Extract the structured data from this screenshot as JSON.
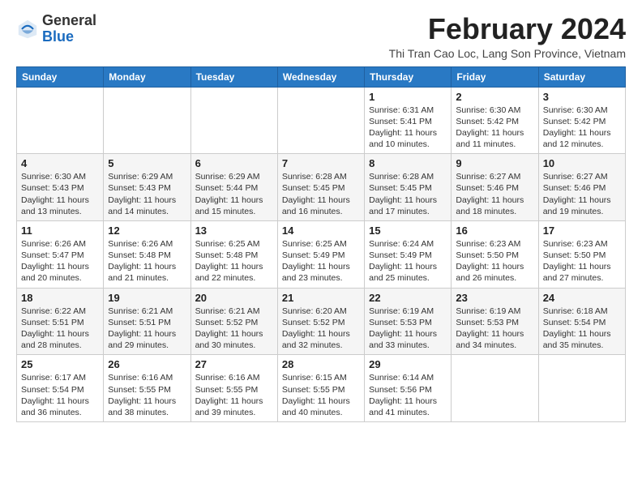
{
  "logo": {
    "general": "General",
    "blue": "Blue"
  },
  "title": "February 2024",
  "subtitle": "Thi Tran Cao Loc, Lang Son Province, Vietnam",
  "weekdays": [
    "Sunday",
    "Monday",
    "Tuesday",
    "Wednesday",
    "Thursday",
    "Friday",
    "Saturday"
  ],
  "weeks": [
    [
      {
        "day": "",
        "info": ""
      },
      {
        "day": "",
        "info": ""
      },
      {
        "day": "",
        "info": ""
      },
      {
        "day": "",
        "info": ""
      },
      {
        "day": "1",
        "info": "Sunrise: 6:31 AM\nSunset: 5:41 PM\nDaylight: 11 hours\nand 10 minutes."
      },
      {
        "day": "2",
        "info": "Sunrise: 6:30 AM\nSunset: 5:42 PM\nDaylight: 11 hours\nand 11 minutes."
      },
      {
        "day": "3",
        "info": "Sunrise: 6:30 AM\nSunset: 5:42 PM\nDaylight: 11 hours\nand 12 minutes."
      }
    ],
    [
      {
        "day": "4",
        "info": "Sunrise: 6:30 AM\nSunset: 5:43 PM\nDaylight: 11 hours\nand 13 minutes."
      },
      {
        "day": "5",
        "info": "Sunrise: 6:29 AM\nSunset: 5:43 PM\nDaylight: 11 hours\nand 14 minutes."
      },
      {
        "day": "6",
        "info": "Sunrise: 6:29 AM\nSunset: 5:44 PM\nDaylight: 11 hours\nand 15 minutes."
      },
      {
        "day": "7",
        "info": "Sunrise: 6:28 AM\nSunset: 5:45 PM\nDaylight: 11 hours\nand 16 minutes."
      },
      {
        "day": "8",
        "info": "Sunrise: 6:28 AM\nSunset: 5:45 PM\nDaylight: 11 hours\nand 17 minutes."
      },
      {
        "day": "9",
        "info": "Sunrise: 6:27 AM\nSunset: 5:46 PM\nDaylight: 11 hours\nand 18 minutes."
      },
      {
        "day": "10",
        "info": "Sunrise: 6:27 AM\nSunset: 5:46 PM\nDaylight: 11 hours\nand 19 minutes."
      }
    ],
    [
      {
        "day": "11",
        "info": "Sunrise: 6:26 AM\nSunset: 5:47 PM\nDaylight: 11 hours\nand 20 minutes."
      },
      {
        "day": "12",
        "info": "Sunrise: 6:26 AM\nSunset: 5:48 PM\nDaylight: 11 hours\nand 21 minutes."
      },
      {
        "day": "13",
        "info": "Sunrise: 6:25 AM\nSunset: 5:48 PM\nDaylight: 11 hours\nand 22 minutes."
      },
      {
        "day": "14",
        "info": "Sunrise: 6:25 AM\nSunset: 5:49 PM\nDaylight: 11 hours\nand 23 minutes."
      },
      {
        "day": "15",
        "info": "Sunrise: 6:24 AM\nSunset: 5:49 PM\nDaylight: 11 hours\nand 25 minutes."
      },
      {
        "day": "16",
        "info": "Sunrise: 6:23 AM\nSunset: 5:50 PM\nDaylight: 11 hours\nand 26 minutes."
      },
      {
        "day": "17",
        "info": "Sunrise: 6:23 AM\nSunset: 5:50 PM\nDaylight: 11 hours\nand 27 minutes."
      }
    ],
    [
      {
        "day": "18",
        "info": "Sunrise: 6:22 AM\nSunset: 5:51 PM\nDaylight: 11 hours\nand 28 minutes."
      },
      {
        "day": "19",
        "info": "Sunrise: 6:21 AM\nSunset: 5:51 PM\nDaylight: 11 hours\nand 29 minutes."
      },
      {
        "day": "20",
        "info": "Sunrise: 6:21 AM\nSunset: 5:52 PM\nDaylight: 11 hours\nand 30 minutes."
      },
      {
        "day": "21",
        "info": "Sunrise: 6:20 AM\nSunset: 5:52 PM\nDaylight: 11 hours\nand 32 minutes."
      },
      {
        "day": "22",
        "info": "Sunrise: 6:19 AM\nSunset: 5:53 PM\nDaylight: 11 hours\nand 33 minutes."
      },
      {
        "day": "23",
        "info": "Sunrise: 6:19 AM\nSunset: 5:53 PM\nDaylight: 11 hours\nand 34 minutes."
      },
      {
        "day": "24",
        "info": "Sunrise: 6:18 AM\nSunset: 5:54 PM\nDaylight: 11 hours\nand 35 minutes."
      }
    ],
    [
      {
        "day": "25",
        "info": "Sunrise: 6:17 AM\nSunset: 5:54 PM\nDaylight: 11 hours\nand 36 minutes."
      },
      {
        "day": "26",
        "info": "Sunrise: 6:16 AM\nSunset: 5:55 PM\nDaylight: 11 hours\nand 38 minutes."
      },
      {
        "day": "27",
        "info": "Sunrise: 6:16 AM\nSunset: 5:55 PM\nDaylight: 11 hours\nand 39 minutes."
      },
      {
        "day": "28",
        "info": "Sunrise: 6:15 AM\nSunset: 5:55 PM\nDaylight: 11 hours\nand 40 minutes."
      },
      {
        "day": "29",
        "info": "Sunrise: 6:14 AM\nSunset: 5:56 PM\nDaylight: 11 hours\nand 41 minutes."
      },
      {
        "day": "",
        "info": ""
      },
      {
        "day": "",
        "info": ""
      }
    ]
  ]
}
